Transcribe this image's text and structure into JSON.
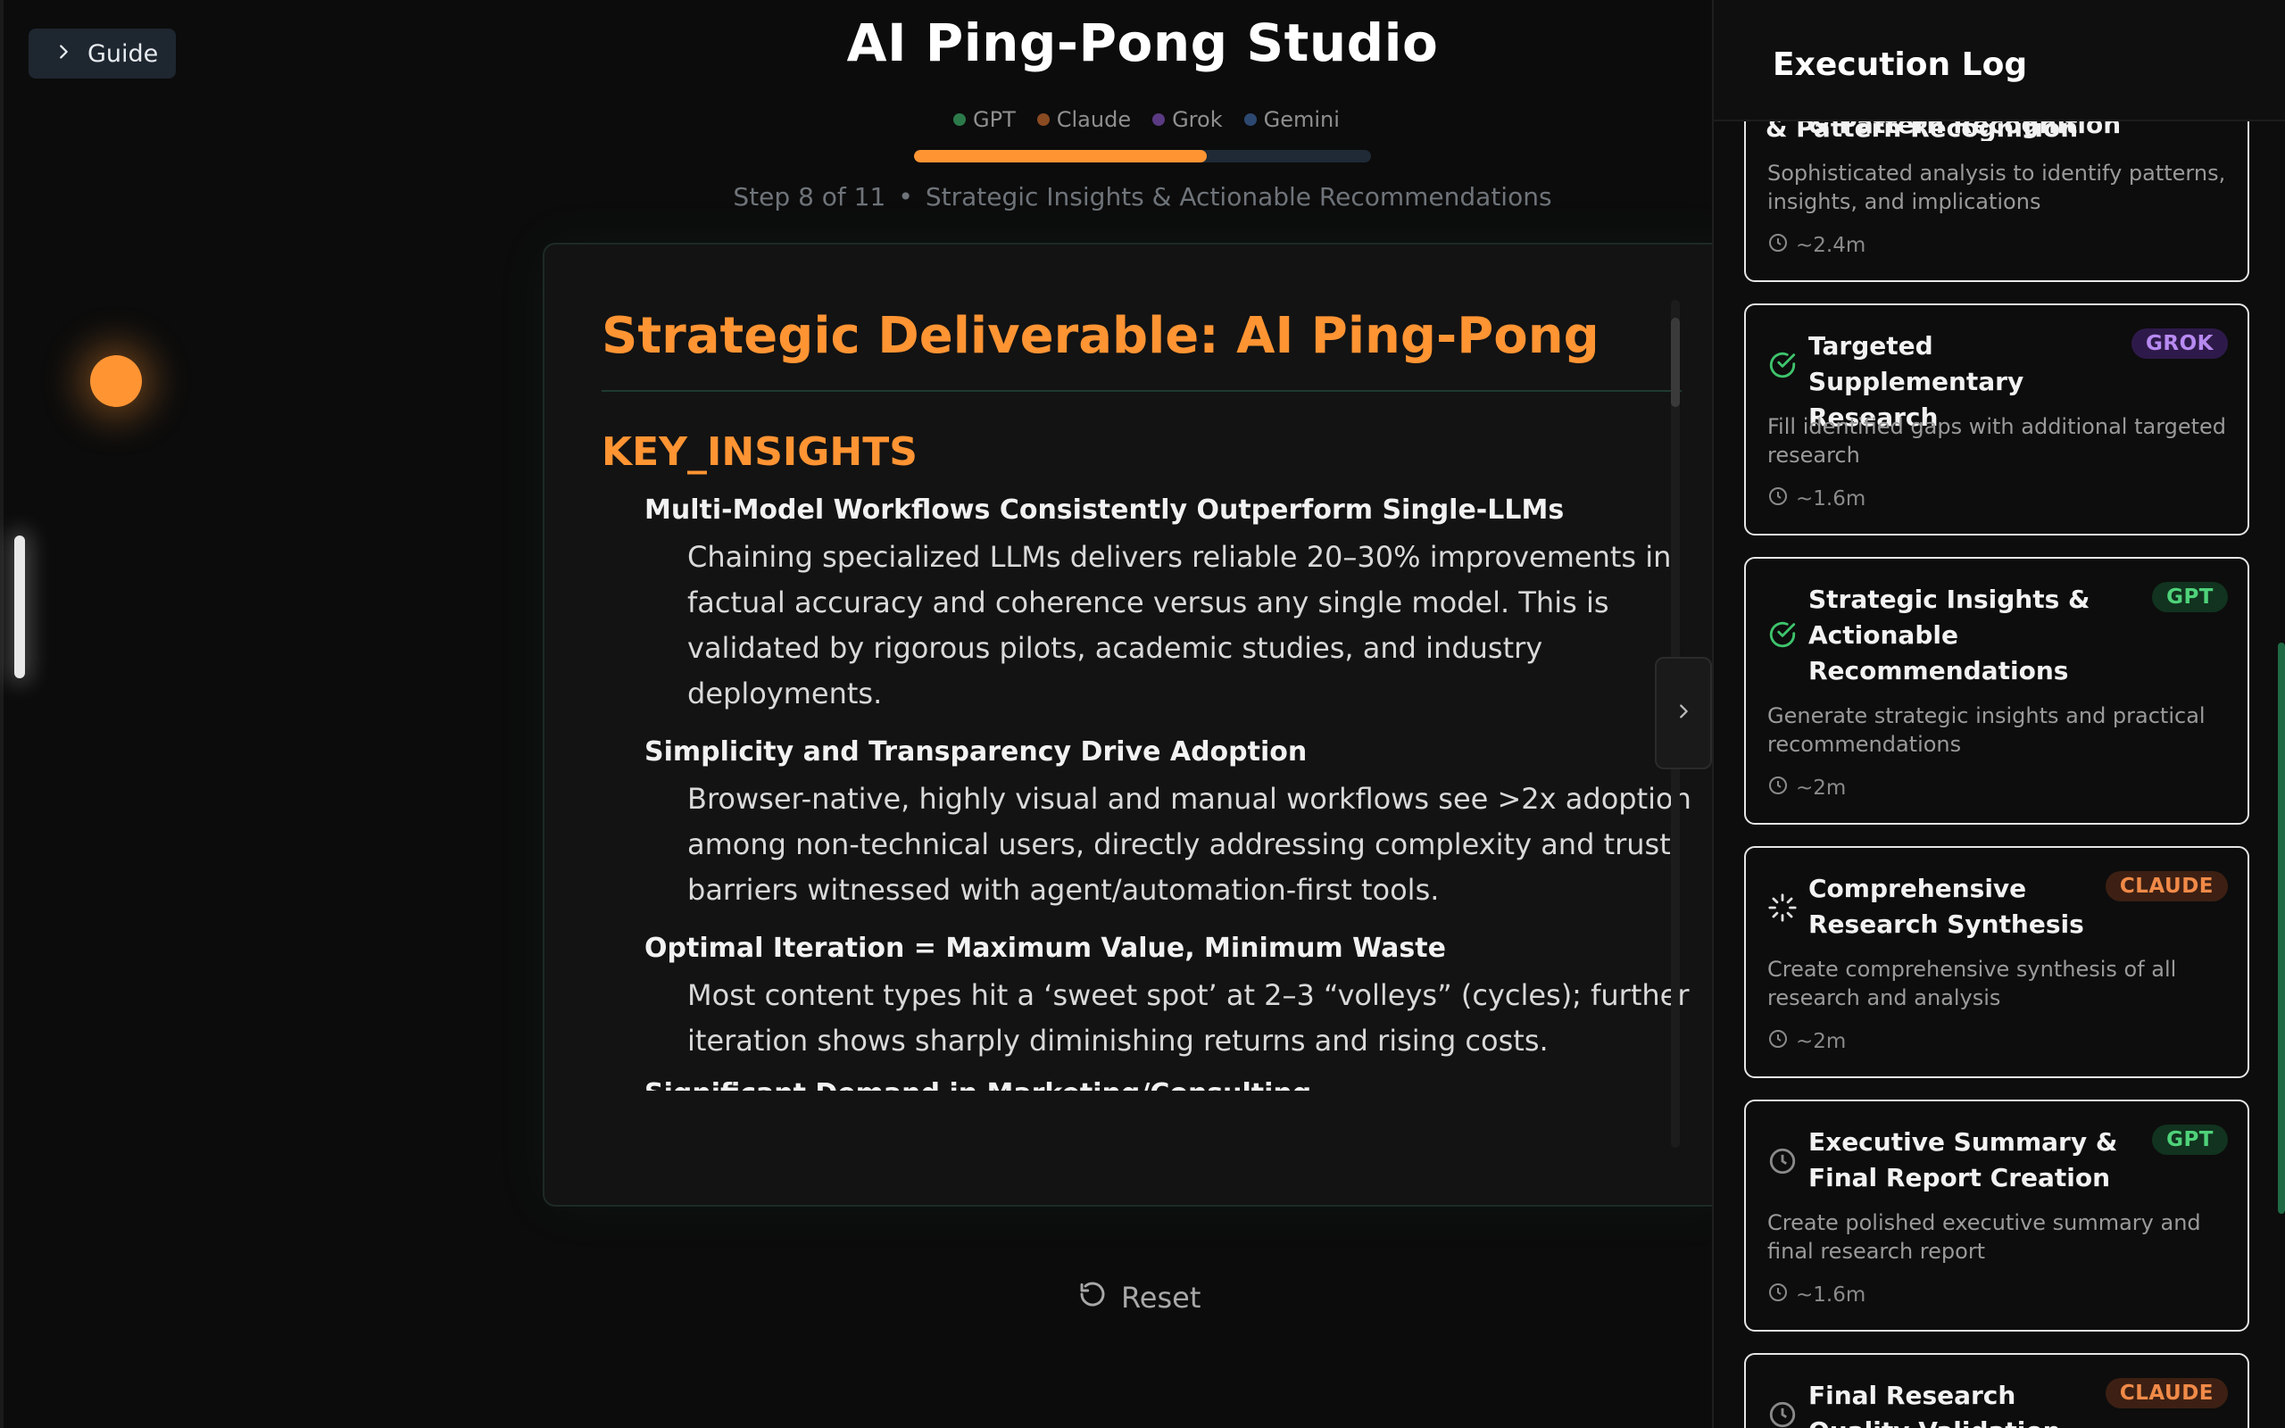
{
  "guide": {
    "label": "Guide",
    "icon": "chevron-right-icon"
  },
  "app": {
    "title": "AI Ping-Pong Studio"
  },
  "legend": [
    {
      "label": "GPT",
      "color": "#2c7a4a"
    },
    {
      "label": "Claude",
      "color": "#8a4a22"
    },
    {
      "label": "Grok",
      "color": "#5a3a82"
    },
    {
      "label": "Gemini",
      "color": "#2d4870"
    }
  ],
  "progress": {
    "fraction": 0.64
  },
  "step": {
    "counter": "Step 8 of 11",
    "separator": "•",
    "name": "Strategic Insights & Actionable Recommendations"
  },
  "deliverable": {
    "title": "Strategic Deliverable: AI Ping-Pong",
    "section": "KEY_INSIGHTS",
    "insights": [
      {
        "title": "Multi-Model Workflows Consistently Outperform Single-LLMs",
        "body": "Chaining specialized LLMs delivers reliable 20–30% improvements in factual accuracy and coherence versus any single model. This is validated by rigorous pilots, academic studies, and industry deployments."
      },
      {
        "title": "Simplicity and Transparency Drive Adoption",
        "body": "Browser-native, highly visual and manual workflows see >2x adoption among non-technical users, directly addressing complexity and trust barriers witnessed with agent/automation-first tools."
      },
      {
        "title": "Optimal Iteration = Maximum Value, Minimum Waste",
        "body": "Most content types hit a ‘sweet spot’ at 2–3 “volleys” (cycles); further iteration shows sharply diminishing returns and rising costs."
      }
    ],
    "cut_off_title": "Significant Demand in Marketing/Consulting"
  },
  "reset": {
    "label": "Reset"
  },
  "panel": {
    "title": "Execution Log",
    "items": [
      {
        "title": "& Pattern Recognition",
        "desc": "Sophisticated analysis to identify patterns, insights, and implications",
        "time": "~2.4m",
        "status": "none",
        "badge": ""
      },
      {
        "title": "Targeted Supplementary Research",
        "desc": "Fill identified gaps with additional targeted research",
        "time": "~1.6m",
        "status": "done",
        "badge": "GROK"
      },
      {
        "title": "Strategic Insights & Actionable Recommendations",
        "desc": "Generate strategic insights and practical recommendations",
        "time": "~2m",
        "status": "done",
        "badge": "GPT"
      },
      {
        "title": "Comprehensive Research Synthesis",
        "desc": "Create comprehensive synthesis of all research and analysis",
        "time": "~2m",
        "status": "running",
        "badge": "CLAUDE"
      },
      {
        "title": "Executive Summary & Final Report Creation",
        "desc": "Create polished executive summary and final research report",
        "time": "~1.6m",
        "status": "pending",
        "badge": "GPT"
      },
      {
        "title": "Final Research Quality Validation",
        "desc": "",
        "time": "",
        "status": "pending",
        "badge": "CLAUDE"
      }
    ]
  },
  "colors": {
    "accent": "#ff9433",
    "done": "#3ec46d"
  }
}
